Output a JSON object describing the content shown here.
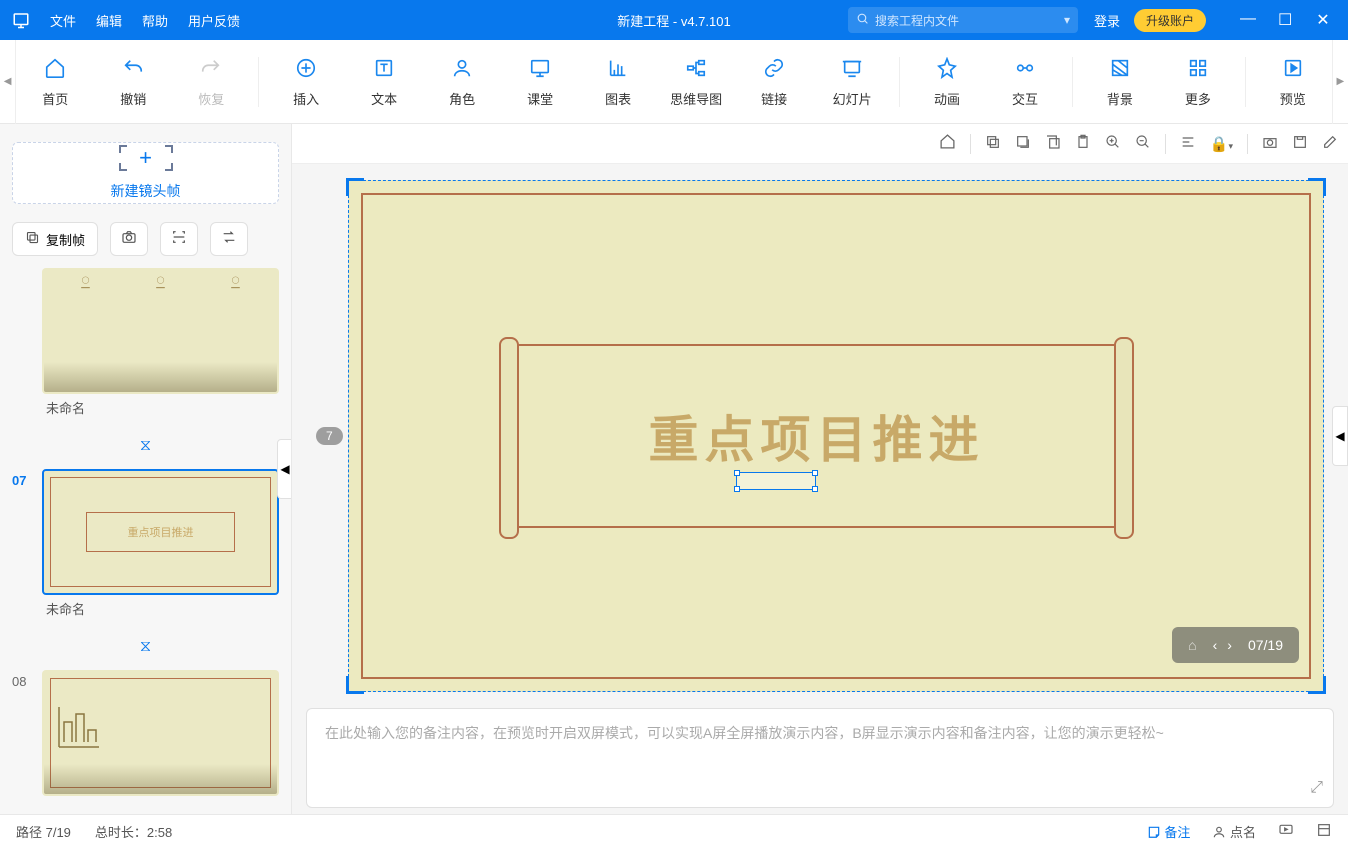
{
  "titlebar": {
    "menus": {
      "file": "文件",
      "edit": "编辑",
      "help": "帮助",
      "feedback": "用户反馈"
    },
    "title": "新建工程 - v4.7.101",
    "search_placeholder": "搜索工程内文件",
    "login": "登录",
    "upgrade": "升级账户"
  },
  "toolbar": {
    "home": "首页",
    "undo": "撤销",
    "redo": "恢复",
    "insert": "插入",
    "text": "文本",
    "role": "角色",
    "class": "课堂",
    "chart": "图表",
    "mindmap": "思维导图",
    "link": "链接",
    "slide": "幻灯片",
    "anim": "动画",
    "interact": "交互",
    "bg": "背景",
    "more": "更多",
    "preview": "预览"
  },
  "sidebar": {
    "new_frame": "新建镜头帧",
    "copy_frame": "复制帧",
    "slides": [
      {
        "num": "",
        "label": "未命名"
      },
      {
        "num": "07",
        "label": "未命名",
        "active": true,
        "title": "重点项目推进"
      },
      {
        "num": "08",
        "label": ""
      }
    ]
  },
  "canvas": {
    "slide_number_badge": "7",
    "title": "重点项目推进",
    "page_indicator": "07/19"
  },
  "notes": {
    "placeholder": "在此处输入您的备注内容，在预览时开启双屏模式，可以实现A屏全屏播放演示内容，B屏显示演示内容和备注内容，让您的演示更轻松~"
  },
  "statusbar": {
    "path": "路径 7/19",
    "duration": "总时长：2:58",
    "notes": "备注",
    "roll": "点名"
  }
}
